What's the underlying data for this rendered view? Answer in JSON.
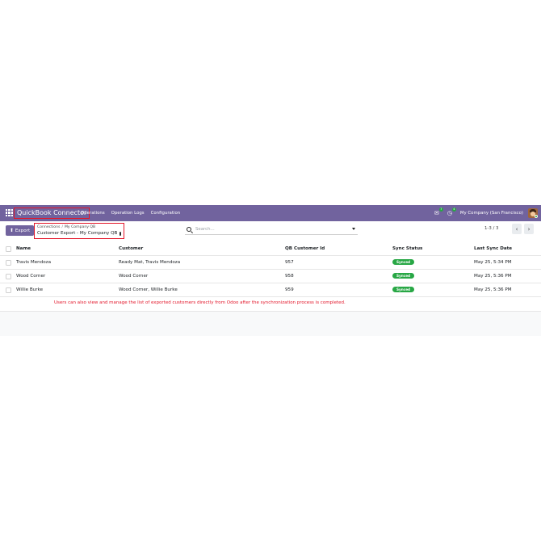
{
  "navbar": {
    "app_title": "QuickBook Connector",
    "menu": [
      "Operations",
      "Operation Logs",
      "Configuration"
    ],
    "messages_count": "7",
    "activities_count": "4",
    "company": "My Company (San Francisco)"
  },
  "control": {
    "export_label": "Export",
    "breadcrumb": [
      "Connections",
      "My Company QB"
    ],
    "current_view": "Customer Export - My Company QB",
    "search_placeholder": "Search...",
    "pager": "1-3 / 3"
  },
  "table": {
    "headers": {
      "name": "Name",
      "customer": "Customer",
      "qb_id": "QB Customer Id",
      "sync_status": "Sync Status",
      "last_sync": "Last Sync Date"
    },
    "rows": [
      {
        "name": "Travis Mendoza",
        "customer": "Ready Mat, Travis Mendoza",
        "qb_id": "957",
        "sync_status": "Synced",
        "last_sync": "May 25, 5:34 PM"
      },
      {
        "name": "Wood Corner",
        "customer": "Wood Corner",
        "qb_id": "958",
        "sync_status": "Synced",
        "last_sync": "May 25, 5:36 PM"
      },
      {
        "name": "Willie Burke",
        "customer": "Wood Corner, Willie Burke",
        "qb_id": "959",
        "sync_status": "Synced",
        "last_sync": "May 25, 5:36 PM"
      }
    ]
  },
  "annotation": "Users can also view and manage the list of exported customers directly from Odoo after the synchronization process is completed.",
  "colors": {
    "navbar": "#71639e",
    "highlight_box": "#e3162a",
    "synced_badge": "#28a745"
  },
  "icons": {
    "apps": "apps-grid-icon",
    "messages": "chat-icon",
    "activities": "clock-icon",
    "export": "upload-icon",
    "settings": "gear-icon",
    "search": "search-icon",
    "prev": "chevron-left-icon",
    "next": "chevron-right-icon"
  }
}
